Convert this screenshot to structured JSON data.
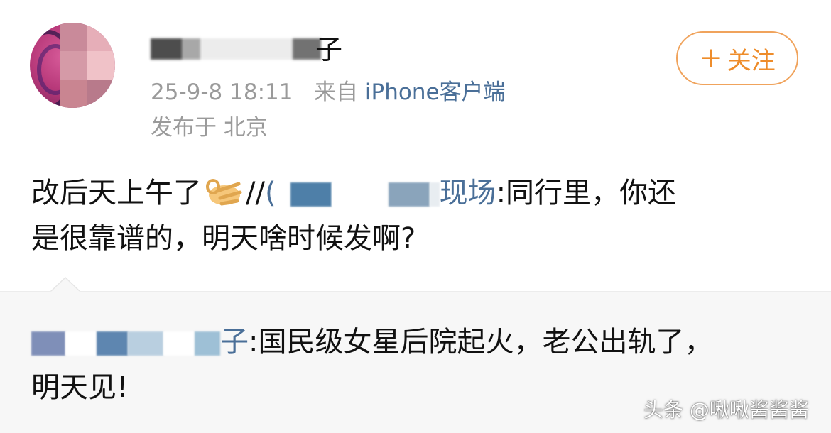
{
  "header": {
    "username_visible_suffix": "子",
    "timestamp": "25-9-8 18:11",
    "source_prefix": "来自",
    "source_client": "iPhone客户端",
    "location": "发布于 北京",
    "follow_plus": "+",
    "follow_label": "关注"
  },
  "post": {
    "text_before_emoji": "改后天上午了",
    "emoji": "ok-hand-emoji",
    "repost_marker": "//",
    "mention_suffix": "现场",
    "repost_text_line1": ":同行里，你还",
    "repost_text_line2": "是很靠谱的，明天啥时候发啊?"
  },
  "quote": {
    "mention_suffix": "子",
    "text_line1": ":国民级女星后院起火，老公出轨了，",
    "text_line2": "明天见!"
  },
  "watermark": {
    "text": "头条 @啾啾酱酱酱"
  },
  "colors": {
    "link_blue": "#4a6f98",
    "follow_orange": "#ee8c2a",
    "meta_gray": "#9a9a9a",
    "quote_bg": "#f7f7f7"
  }
}
